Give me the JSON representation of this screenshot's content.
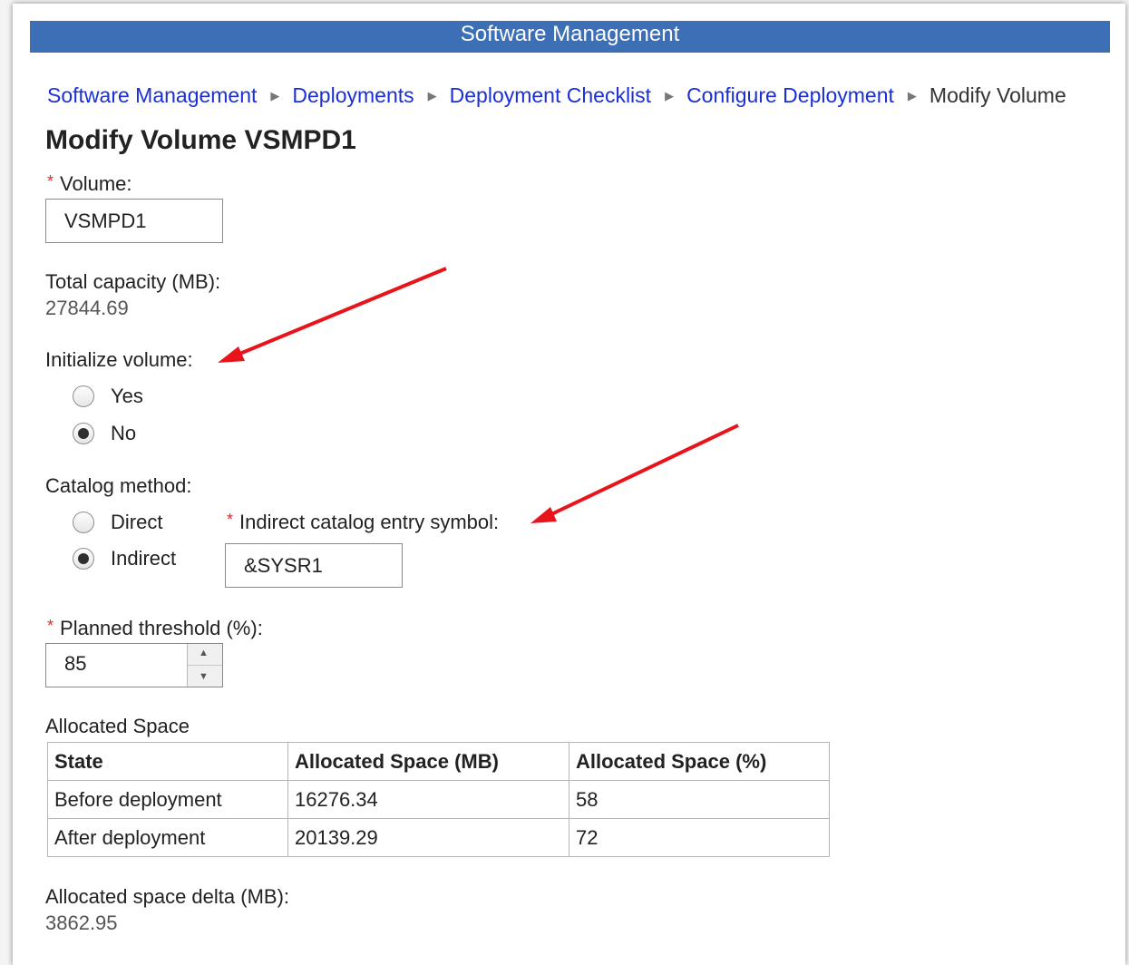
{
  "header": {
    "title": "Software Management"
  },
  "breadcrumb": {
    "items": [
      "Software Management",
      "Deployments",
      "Deployment Checklist",
      "Configure Deployment"
    ],
    "current": "Modify Volume"
  },
  "page": {
    "title": "Modify Volume VSMPD1"
  },
  "form": {
    "required_marker": "*",
    "volume": {
      "label": "Volume:",
      "value": "VSMPD1"
    },
    "total_capacity": {
      "label": "Total capacity (MB):",
      "value": "27844.69"
    },
    "initialize": {
      "label": "Initialize volume:",
      "options": [
        "Yes",
        "No"
      ],
      "selected": "No"
    },
    "catalog": {
      "label": "Catalog method:",
      "options": [
        "Direct",
        "Indirect"
      ],
      "selected": "Indirect",
      "symbol_label": "Indirect catalog entry symbol:",
      "symbol_value": "&SYSR1"
    },
    "threshold": {
      "label": "Planned threshold (%):",
      "value": "85"
    },
    "allocated": {
      "label": "Allocated Space",
      "columns": [
        "State",
        "Allocated Space (MB)",
        "Allocated Space (%)"
      ],
      "rows": [
        [
          "Before deployment",
          "16276.34",
          "58"
        ],
        [
          "After deployment",
          "20139.29",
          "72"
        ]
      ]
    },
    "delta": {
      "label": "Allocated space delta (MB):",
      "value": "3862.95"
    }
  },
  "colors": {
    "header_bar": "#3d6fb6",
    "link": "#1a2fd6",
    "annotation_arrow": "#e8141c",
    "required": "#e4262c"
  }
}
